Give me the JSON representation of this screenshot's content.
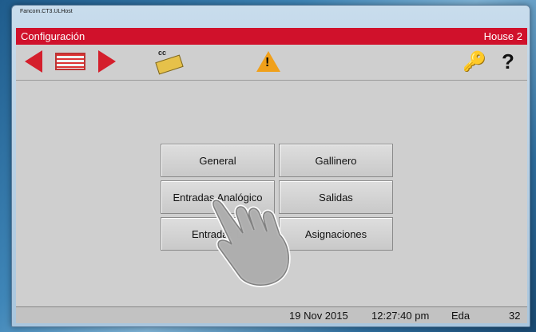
{
  "window": {
    "title": "Fancom.CT3.ULHost"
  },
  "header": {
    "title": "Configuración",
    "location": "House 2"
  },
  "toolbar": {
    "items": [
      {
        "name": "prev-arrow-icon"
      },
      {
        "name": "panel-icon"
      },
      {
        "name": "next-arrow-icon"
      },
      {
        "name": "cc-card-icon",
        "label": "cc"
      },
      {
        "name": "warning-icon",
        "label": "!"
      },
      {
        "name": "key-icon"
      },
      {
        "name": "help-icon",
        "label": "?"
      }
    ]
  },
  "menu": {
    "general": "General",
    "gallinero": "Gallinero",
    "entradas_analogico": "Entradas Analógico",
    "salidas": "Salidas",
    "entradas_digital": "Entradas D",
    "asignaciones": "Asignaciones"
  },
  "status": {
    "date": "19 Nov 2015",
    "time": "12:27:40 pm",
    "user": "Eda",
    "number": "32"
  },
  "colors": {
    "header": "#d0112b",
    "arrow": "#d41f2c",
    "background": "#cfcfcf"
  }
}
